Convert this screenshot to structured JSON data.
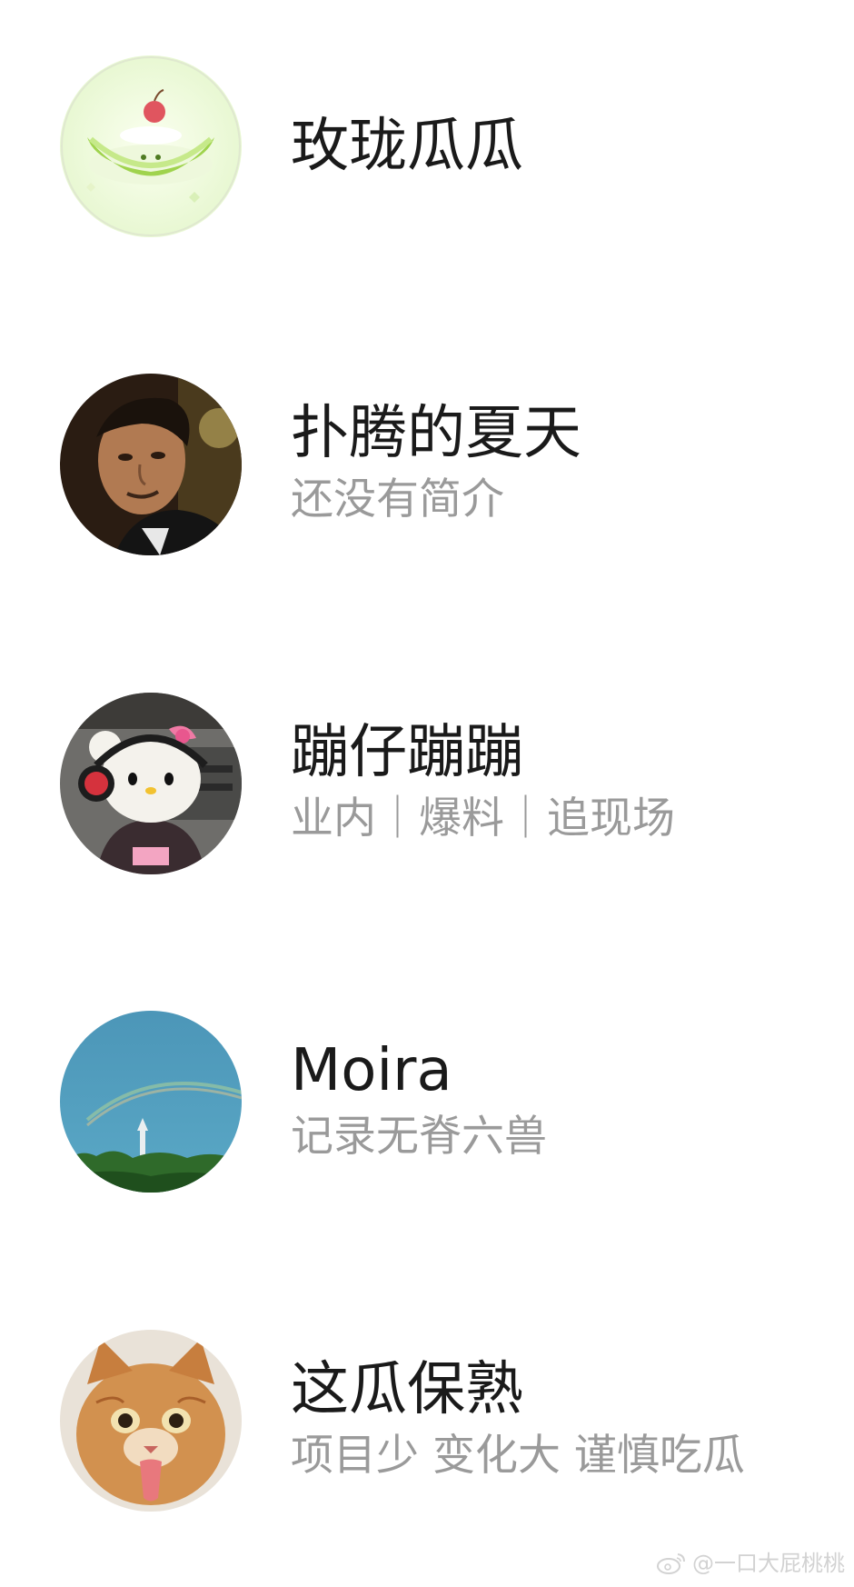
{
  "users": [
    {
      "name": "玫珑瓜瓜",
      "bio": "",
      "avatar_icon": "melon-cake-icon"
    },
    {
      "name": "扑腾的夏天",
      "bio": "还没有简介",
      "avatar_icon": "man-portrait-icon"
    },
    {
      "name": "蹦仔蹦蹦",
      "bio": "业内｜爆料｜追现场",
      "avatar_icon": "hello-kitty-headphones-icon"
    },
    {
      "name": "Moira",
      "bio": "记录无脊六兽",
      "avatar_icon": "sky-rainbow-icon"
    },
    {
      "name": "这瓜保熟",
      "bio": "项目少 变化大 谨慎吃瓜",
      "avatar_icon": "orange-kitten-icon"
    }
  ],
  "watermark": {
    "icon": "weibo-logo-icon",
    "text": "@一口大屁桃桃"
  }
}
